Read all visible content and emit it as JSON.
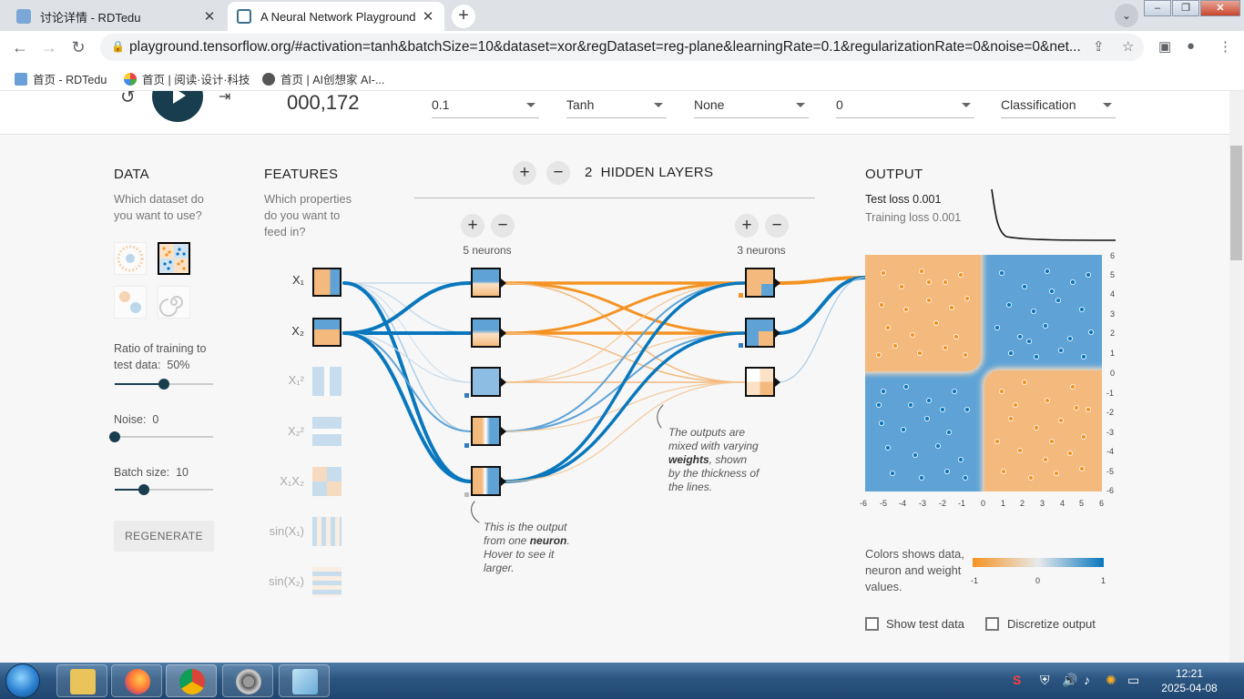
{
  "browser": {
    "tabs": [
      {
        "title": "讨论详情 - RDTedu",
        "active": false
      },
      {
        "title": "A Neural Network Playground",
        "active": true
      }
    ],
    "url": "playground.tensorflow.org/#activation=tanh&batchSize=10&dataset=xor&regDataset=reg-plane&learningRate=0.1&regularizationRate=0&noise=0&net...",
    "bookmarks": [
      {
        "label": "首页 - RDTedu"
      },
      {
        "label": "首页 | 阅读·设计·科技"
      },
      {
        "label": "首页 | AI创想家 AI-..."
      }
    ]
  },
  "controls": {
    "epoch": "000,172",
    "learning_rate": "0.1",
    "activation": "Tanh",
    "regularization": "None",
    "regularization_rate": "0",
    "problem_type": "Classification"
  },
  "data_panel": {
    "title": "DATA",
    "question": "Which dataset do you want to use?",
    "ratio_label": "Ratio of training to test data:",
    "ratio_value": "50%",
    "ratio_fraction": 0.5,
    "noise_label": "Noise:",
    "noise_value": "0",
    "noise_fraction": 0,
    "batch_label": "Batch size:",
    "batch_value": "10",
    "batch_fraction": 0.3,
    "regenerate_label": "REGENERATE"
  },
  "features_panel": {
    "title": "FEATURES",
    "question": "Which properties do you want to feed in?",
    "features": [
      {
        "label": "X₁",
        "active": true
      },
      {
        "label": "X₂",
        "active": true
      },
      {
        "label": "X₁²",
        "active": false
      },
      {
        "label": "X₂²",
        "active": false
      },
      {
        "label": "X₁X₂",
        "active": false
      },
      {
        "label": "sin(X₁)",
        "active": false
      },
      {
        "label": "sin(X₂)",
        "active": false
      }
    ]
  },
  "network": {
    "hidden_layers_count": "2",
    "hidden_layers_label": "HIDDEN LAYERS",
    "layers": [
      {
        "neurons_label": "5 neurons"
      },
      {
        "neurons_label": "3 neurons"
      }
    ],
    "note_neuron": {
      "pre": "This is the output from one",
      "bold": "neuron",
      "post": ". Hover to see it larger."
    },
    "note_weights": {
      "pre": "The outputs are mixed with varying",
      "bold": "weights",
      "post": ", shown by the thickness of the lines."
    }
  },
  "output_panel": {
    "title": "OUTPUT",
    "test_loss_label": "Test loss",
    "test_loss": "0.001",
    "training_loss_label": "Training loss",
    "training_loss": "0.001",
    "y_ticks": [
      "6",
      "5",
      "4",
      "3",
      "2",
      "1",
      "0",
      "-1",
      "-2",
      "-3",
      "-4",
      "-5",
      "-6"
    ],
    "x_ticks": [
      "-6",
      "-5",
      "-4",
      "-3",
      "-2",
      "-1",
      "0",
      "1",
      "2",
      "3",
      "4",
      "5",
      "6"
    ],
    "colors_note": "Colors shows data, neuron and weight values.",
    "colorbar_ticks": [
      "-1",
      "0",
      "1"
    ],
    "show_test_data_label": "Show test data",
    "discretize_label": "Discretize output"
  },
  "colors": {
    "orange": "#f59322",
    "blue": "#0877bd",
    "light_orange": "#f4b97c",
    "light_blue": "#5fa3d6"
  },
  "taskbar": {
    "time": "12:21",
    "date": "2025-04-08"
  }
}
